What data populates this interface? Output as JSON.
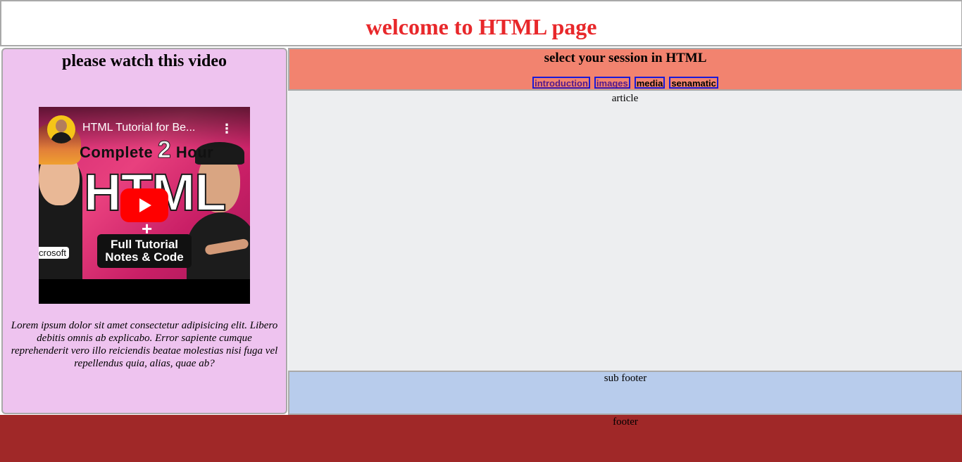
{
  "header": {
    "title": "welcome to HTML page",
    "title_color": "#e8282b"
  },
  "aside": {
    "heading": "please watch this video",
    "background": "#eec3ef",
    "video": {
      "title": "HTML Tutorial for Be...",
      "thumbnail_line1": "Complete",
      "thumbnail_two": "2",
      "thumbnail_line1b": "Hour",
      "thumbnail_big": "HTML",
      "thumbnail_plus": "+",
      "thumbnail_box_line1": "Full Tutorial",
      "thumbnail_box_line2": "Notes &  Code",
      "thumbnail_badge": "crosoft",
      "menu_icon": "kebab-menu-icon",
      "play_icon": "youtube-play-icon"
    },
    "caption": "Lorem ipsum dolor sit amet consectetur adipisicing elit. Libero debitis omnis ab explicabo. Error sapiente cumque reprehenderit vero illo reiciendis beatae molestias nisi fuga vel repellendus quia, alias, quae ab?"
  },
  "nav": {
    "heading": "select your session in HTML",
    "background": "#f2836f",
    "links": [
      {
        "label": "introduction",
        "visited": true
      },
      {
        "label": "images",
        "visited": true
      },
      {
        "label": "media",
        "visited": false
      },
      {
        "label": "senamatic",
        "visited": false
      }
    ],
    "link_border_color": "#1a1ad8"
  },
  "article": {
    "label": "article",
    "background": "#edeef0"
  },
  "subfooter": {
    "label": "sub footer",
    "background": "#b8ccec"
  },
  "footer": {
    "label": "footer",
    "background": "#a02828"
  }
}
